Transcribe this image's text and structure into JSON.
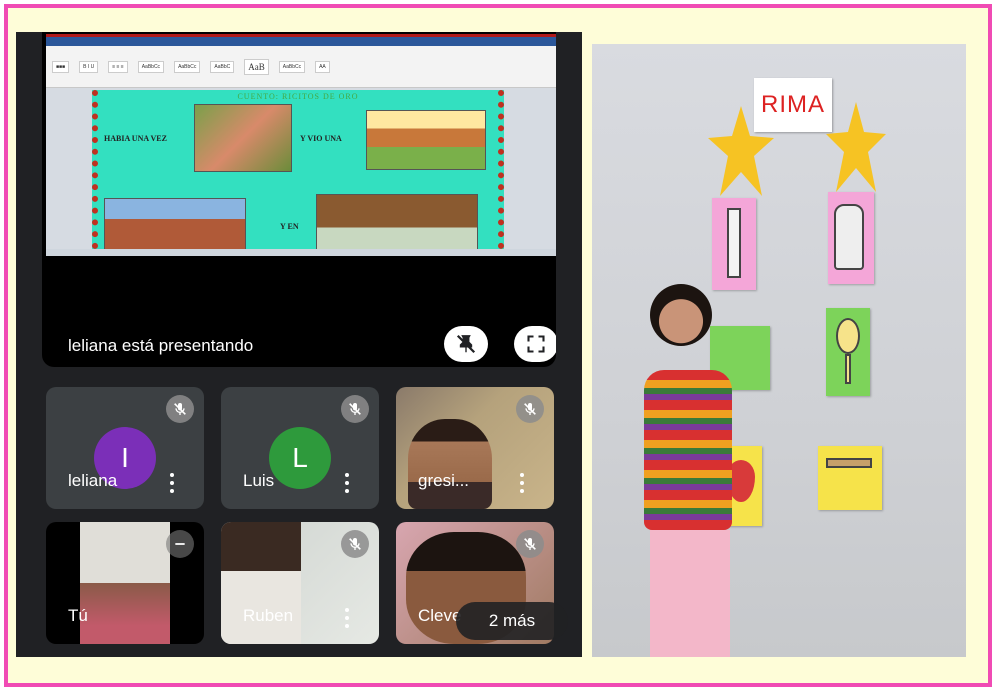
{
  "meeting": {
    "presenting_text": "leliana está presentando",
    "more_label": "2 más",
    "participants": [
      {
        "name": "leliana",
        "initial": "I",
        "avatar_color": "#7b2fb8"
      },
      {
        "name": "Luis",
        "initial": "L",
        "avatar_color": "#2e9a3c"
      },
      {
        "name": "gresi..."
      },
      {
        "name": "Tú"
      },
      {
        "name": "Ruben"
      },
      {
        "name": "Cleve"
      }
    ]
  },
  "document": {
    "title": "CUENTO: RICITOS DE ORO",
    "line1": "HABIA UNA VEZ",
    "line2": "Y VIO UNA",
    "line3": "Y EN"
  },
  "photo": {
    "sign_text": "RIMA"
  },
  "colors": {
    "frame_border": "#f04bb4",
    "frame_background": "#fefdd8",
    "meet_background": "#202124"
  }
}
